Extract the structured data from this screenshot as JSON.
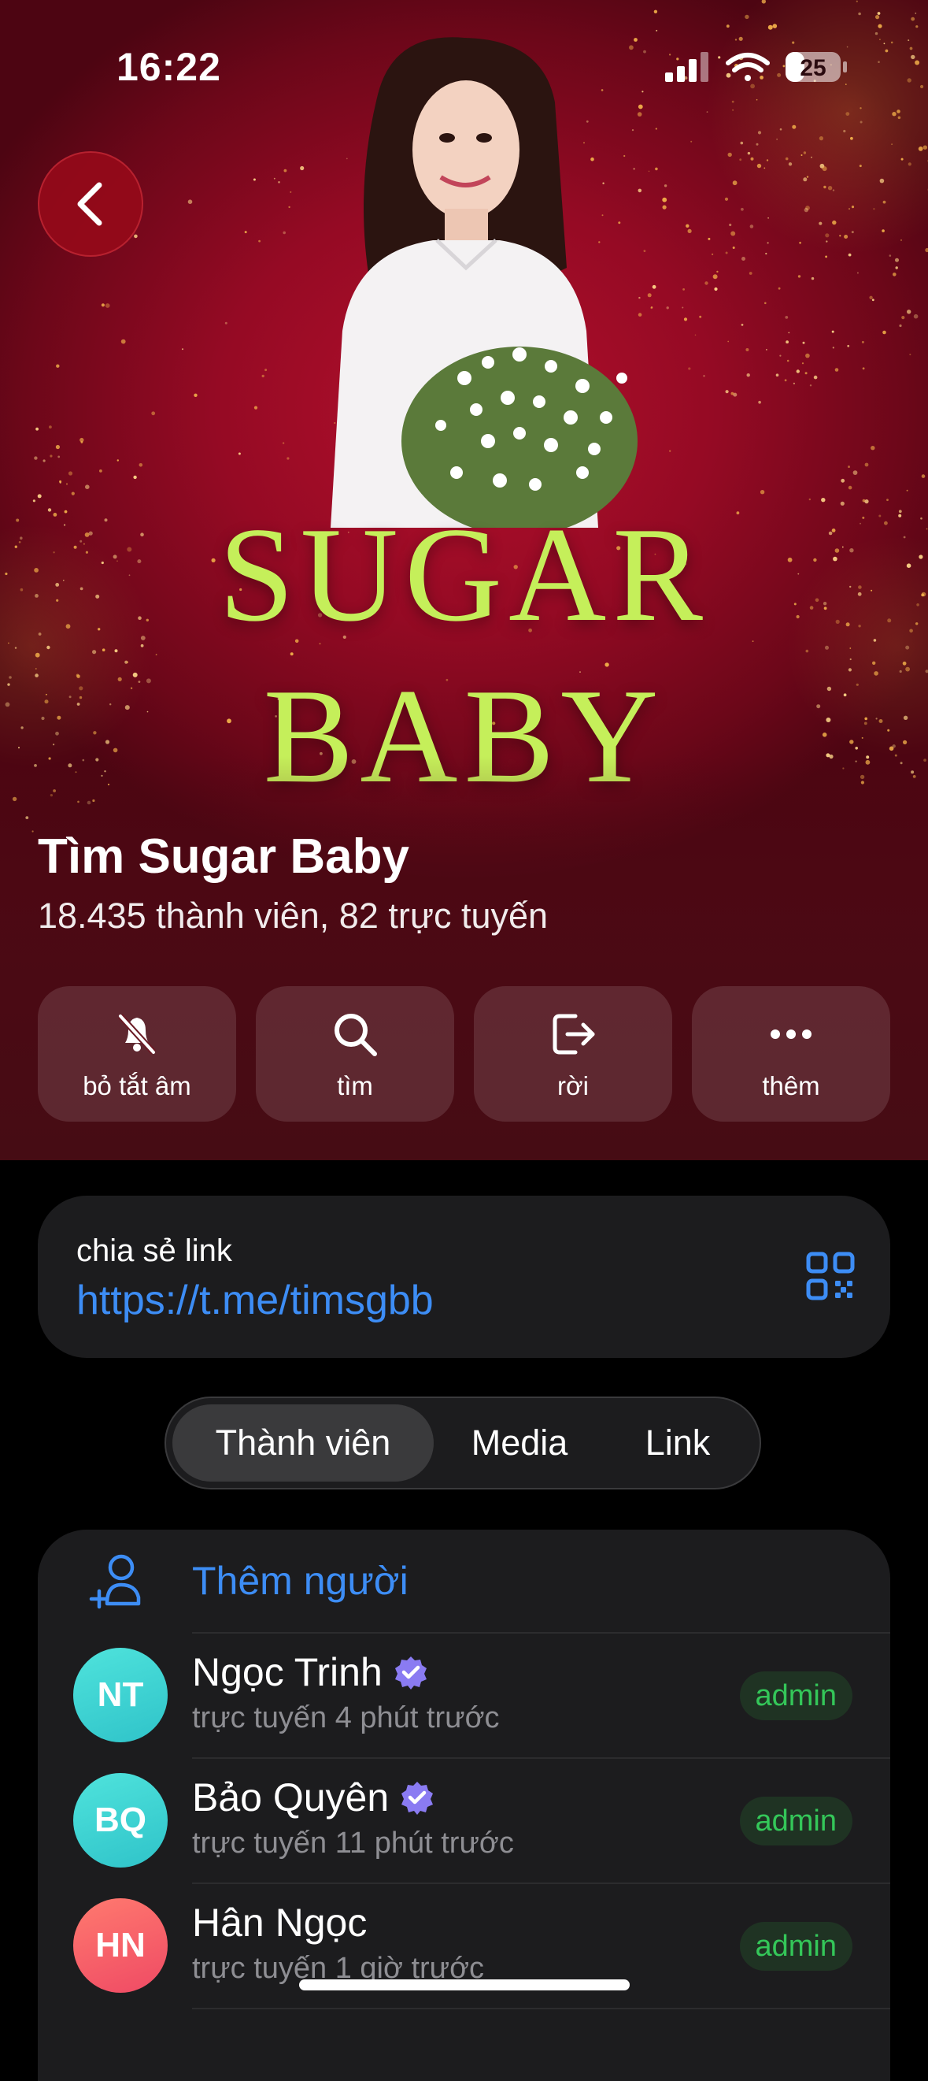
{
  "status_bar": {
    "time": "16:22",
    "battery": "25"
  },
  "banner": {
    "line1": "SUGAR",
    "line2": "BABY"
  },
  "group": {
    "title": "Tìm Sugar Baby",
    "subtitle": "18.435 thành viên, 82 trực tuyến"
  },
  "actions": [
    {
      "label": "bỏ tắt âm",
      "icon": "bell-slash-icon"
    },
    {
      "label": "tìm",
      "icon": "search-icon"
    },
    {
      "label": "rời",
      "icon": "leave-icon"
    },
    {
      "label": "thêm",
      "icon": "more-icon"
    }
  ],
  "share": {
    "label": "chia sẻ link",
    "url": "https://t.me/timsgbb"
  },
  "tabs": [
    {
      "label": "Thành viên",
      "active": true
    },
    {
      "label": "Media",
      "active": false
    },
    {
      "label": "Link",
      "active": false
    }
  ],
  "members": {
    "add_label": "Thêm người",
    "list": [
      {
        "initials": "NT",
        "name": "Ngọc Trinh",
        "verified": true,
        "status": "trực tuyến 4 phút trước",
        "role": "admin",
        "color": "#3dd6d0"
      },
      {
        "initials": "BQ",
        "name": "Bảo Quyên",
        "verified": true,
        "status": "trực tuyến 11 phút trước",
        "role": "admin",
        "color": "#3dd6d0"
      },
      {
        "initials": "HN",
        "name": "Hân Ngọc",
        "verified": false,
        "status": "trực tuyến 1 giờ trước",
        "role": "admin",
        "color": "#f2565f"
      }
    ]
  },
  "colors": {
    "accent": "#3d8df5",
    "admin_badge": "#34c759",
    "hero": "#950a24"
  }
}
